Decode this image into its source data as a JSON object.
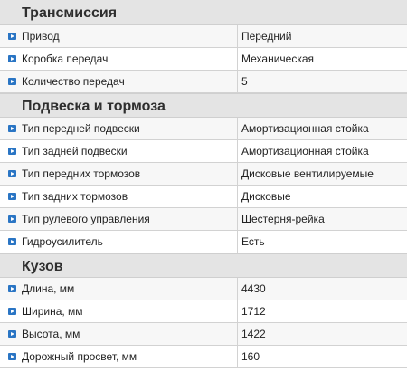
{
  "sections": [
    {
      "title": "Трансмиссия",
      "rows": [
        {
          "label": "Привод",
          "value": "Передний"
        },
        {
          "label": "Коробка передач",
          "value": "Механическая"
        },
        {
          "label": "Количество передач",
          "value": "5"
        }
      ]
    },
    {
      "title": "Подвеска и тормоза",
      "rows": [
        {
          "label": "Тип передней подвески",
          "value": "Амортизационная стойка"
        },
        {
          "label": "Тип задней подвески",
          "value": "Амортизационная стойка"
        },
        {
          "label": "Тип передних тормозов",
          "value": "Дисковые вентилируемые"
        },
        {
          "label": "Тип задних тормозов",
          "value": "Дисковые"
        },
        {
          "label": "Тип рулевого управления",
          "value": "Шестерня-рейка"
        },
        {
          "label": "Гидроусилитель",
          "value": "Есть"
        }
      ]
    },
    {
      "title": "Кузов",
      "rows": [
        {
          "label": "Длина, мм",
          "value": "4430"
        },
        {
          "label": "Ширина, мм",
          "value": "1712"
        },
        {
          "label": "Высота, мм",
          "value": "1422"
        },
        {
          "label": "Дорожный просвет, мм",
          "value": "160"
        }
      ]
    }
  ],
  "icons": {
    "row_bullet": "arrow-right-square-icon"
  },
  "colors": {
    "bullet": "#2a75c4",
    "header_bg": "#e4e4e4"
  }
}
